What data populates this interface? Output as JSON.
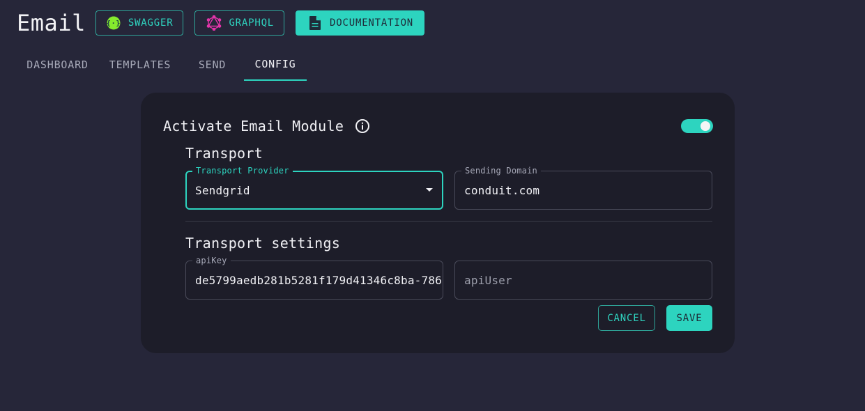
{
  "header": {
    "title": "Email",
    "buttons": [
      {
        "label": "SWAGGER",
        "icon": "swagger-icon"
      },
      {
        "label": "GRAPHQL",
        "icon": "graphql-icon"
      },
      {
        "label": "DOCUMENTATION",
        "icon": "document-icon"
      }
    ]
  },
  "tabs": [
    {
      "label": "DASHBOARD",
      "active": false
    },
    {
      "label": "TEMPLATES",
      "active": false
    },
    {
      "label": "SEND",
      "active": false
    },
    {
      "label": "CONFIG",
      "active": true
    }
  ],
  "config": {
    "activate_label": "Activate Email Module",
    "info_icon": "info-icon",
    "module_enabled": true,
    "transport_title": "Transport",
    "transport_provider": {
      "label": "Transport Provider",
      "value": "Sendgrid"
    },
    "sending_domain": {
      "label": "Sending Domain",
      "value": "conduit.com"
    },
    "transport_settings_title": "Transport settings",
    "api_key": {
      "label": "apiKey",
      "value": "de5799aedb281b5281f179d41346c8ba-786"
    },
    "api_user": {
      "placeholder": "apiUser"
    },
    "cancel_label": "CANCEL",
    "save_label": "SAVE"
  },
  "colors": {
    "background": "#262639",
    "card": "#1d1d29",
    "accent": "#2dd4bf",
    "swagger_icon": "#85ea2d",
    "graphql_icon": "#e535ab"
  }
}
